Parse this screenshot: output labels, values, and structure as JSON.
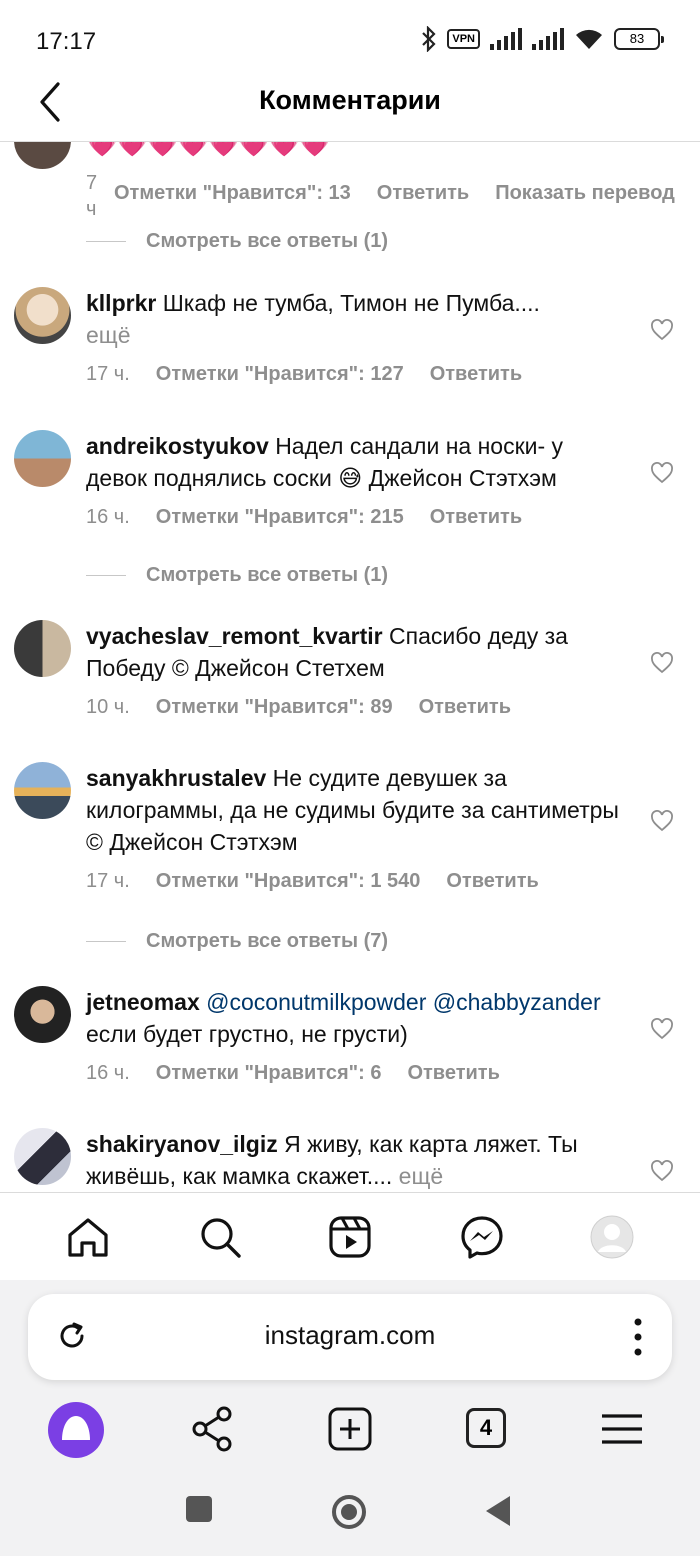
{
  "status_bar": {
    "time": "17:17",
    "vpn": "VPN",
    "battery": "83"
  },
  "header": {
    "title": "Комментарии"
  },
  "partial_comment": {
    "time": "7 ч",
    "likes": "Отметки \"Нравится\": 13",
    "reply": "Ответить",
    "translate": "Показать перевод",
    "view_replies": "Смотреть все ответы (1)"
  },
  "comments": [
    {
      "user": "kllprkr",
      "text": "Шкаф не тумба, Тимон не Пумба....",
      "more": "ещё",
      "time": "17 ч.",
      "likes": "Отметки \"Нравится\": 127",
      "reply": "Ответить"
    },
    {
      "user": "andreikostyukov",
      "text": "Надел сандали на носки- у девок поднялись соски 😅 Джейсон Стэтхэм",
      "time": "16 ч.",
      "likes": "Отметки \"Нравится\": 215",
      "reply": "Ответить",
      "view_replies": "Смотреть все ответы (1)"
    },
    {
      "user": "vyacheslav_remont_kvartir",
      "text": "Спасибо деду за Победу © Джейсон Стетхем",
      "time": "10 ч.",
      "likes": "Отметки \"Нравится\": 89",
      "reply": "Ответить"
    },
    {
      "user": "sanyakhrustalev",
      "text": "Не судите девушек за килограммы, да не судимы будите за сантиметры © Джейсон Стэтхэм",
      "time": "17 ч.",
      "likes": "Отметки \"Нравится\": 1 540",
      "reply": "Ответить",
      "view_replies": "Смотреть все ответы (7)"
    },
    {
      "user": "jetneomax",
      "mention1": "@coconutmilkpowder",
      "mention2": "@chabbyzander",
      "text": "если будет грустно, не грусти)",
      "time": "16 ч.",
      "likes": "Отметки \"Нравится\": 6",
      "reply": "Ответить"
    },
    {
      "user": "shakiryanov_ilgiz",
      "text": "Я живу, как карта ляжет. Ты живёшь, как мамка скажет....",
      "more": "ещё"
    }
  ],
  "browser": {
    "url": "instagram.com",
    "tabs_count": "4"
  },
  "colors": {
    "accent_alice": "#7b3fe4",
    "muted": "#8e8e8e",
    "mention": "#00376b"
  }
}
